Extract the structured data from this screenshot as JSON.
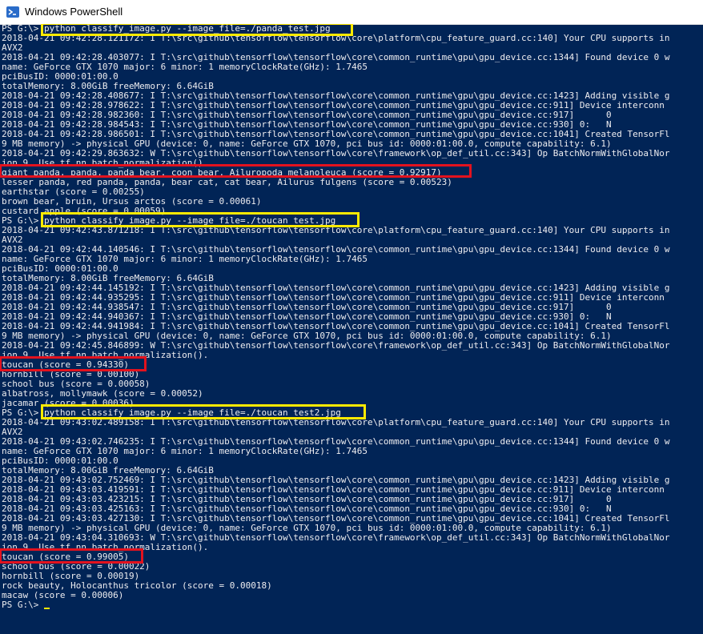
{
  "window": {
    "title": "Windows PowerShell",
    "icon": "powershell-icon",
    "colors": {
      "background": "#012456",
      "text": "#eeedf0",
      "command_highlight": "#ffea00",
      "result_highlight": "#e3121e"
    }
  },
  "console": {
    "prompt": "PS G:\\>",
    "lines": [
      "PS G:\\> python classify_image.py --image_file=./panda_test.jpg",
      "2018-04-21 09:42:28.121172: I T:\\src\\github\\tensorflow\\tensorflow\\core\\platform\\cpu_feature_guard.cc:140] Your CPU supports in",
      "AVX2",
      "2018-04-21 09:42:28.403077: I T:\\src\\github\\tensorflow\\tensorflow\\core\\common_runtime\\gpu\\gpu_device.cc:1344] Found device 0 w",
      "name: GeForce GTX 1070 major: 6 minor: 1 memoryClockRate(GHz): 1.7465",
      "pciBusID: 0000:01:00.0",
      "totalMemory: 8.00GiB freeMemory: 6.64GiB",
      "2018-04-21 09:42:28.408677: I T:\\src\\github\\tensorflow\\tensorflow\\core\\common_runtime\\gpu\\gpu_device.cc:1423] Adding visible g",
      "2018-04-21 09:42:28.978622: I T:\\src\\github\\tensorflow\\tensorflow\\core\\common_runtime\\gpu\\gpu_device.cc:911] Device interconn",
      "2018-04-21 09:42:28.982360: I T:\\src\\github\\tensorflow\\tensorflow\\core\\common_runtime\\gpu\\gpu_device.cc:917]      0",
      "2018-04-21 09:42:28.984543: I T:\\src\\github\\tensorflow\\tensorflow\\core\\common_runtime\\gpu\\gpu_device.cc:930] 0:   N",
      "2018-04-21 09:42:28.986501: I T:\\src\\github\\tensorflow\\tensorflow\\core\\common_runtime\\gpu\\gpu_device.cc:1041] Created TensorFl",
      "9 MB memory) -> physical GPU (device: 0, name: GeForce GTX 1070, pci bus id: 0000:01:00.0, compute capability: 6.1)",
      "2018-04-21 09:42:29.863632: W T:\\src\\github\\tensorflow\\tensorflow\\core\\framework\\op_def_util.cc:343] Op BatchNormWithGlobalNor",
      "ion 9. Use tf.nn.batch_normalization().",
      "giant panda, panda, panda bear, coon bear, Ailuropoda melanoleuca (score = 0.92917)",
      "lesser panda, red panda, panda, bear cat, cat bear, Ailurus fulgens (score = 0.00523)",
      "earthstar (score = 0.00255)",
      "brown bear, bruin, Ursus arctos (score = 0.00061)",
      "custard apple (score = 0.00059)",
      "PS G:\\> python classify_image.py --image_file=./toucan_test.jpg",
      "2018-04-21 09:42:43.871218: I T:\\src\\github\\tensorflow\\tensorflow\\core\\platform\\cpu_feature_guard.cc:140] Your CPU supports in",
      "AVX2",
      "2018-04-21 09:42:44.140546: I T:\\src\\github\\tensorflow\\tensorflow\\core\\common_runtime\\gpu\\gpu_device.cc:1344] Found device 0 w",
      "name: GeForce GTX 1070 major: 6 minor: 1 memoryClockRate(GHz): 1.7465",
      "pciBusID: 0000:01:00.0",
      "totalMemory: 8.00GiB freeMemory: 6.64GiB",
      "2018-04-21 09:42:44.145192: I T:\\src\\github\\tensorflow\\tensorflow\\core\\common_runtime\\gpu\\gpu_device.cc:1423] Adding visible g",
      "2018-04-21 09:42:44.935295: I T:\\src\\github\\tensorflow\\tensorflow\\core\\common_runtime\\gpu\\gpu_device.cc:911] Device interconn",
      "2018-04-21 09:42:44.938547: I T:\\src\\github\\tensorflow\\tensorflow\\core\\common_runtime\\gpu\\gpu_device.cc:917]      0",
      "2018-04-21 09:42:44.940367: I T:\\src\\github\\tensorflow\\tensorflow\\core\\common_runtime\\gpu\\gpu_device.cc:930] 0:   N",
      "2018-04-21 09:42:44.941984: I T:\\src\\github\\tensorflow\\tensorflow\\core\\common_runtime\\gpu\\gpu_device.cc:1041] Created TensorFl",
      "9 MB memory) -> physical GPU (device: 0, name: GeForce GTX 1070, pci bus id: 0000:01:00.0, compute capability: 6.1)",
      "2018-04-21 09:42:45.846899: W T:\\src\\github\\tensorflow\\tensorflow\\core\\framework\\op_def_util.cc:343] Op BatchNormWithGlobalNor",
      "ion 9. Use tf.nn.batch_normalization().",
      "toucan (score = 0.94330)",
      "hornbill (score = 0.00100)",
      "school bus (score = 0.00058)",
      "albatross, mollymawk (score = 0.00052)",
      "jacamar (score = 0.00036)",
      "PS G:\\> python classify_image.py --image_file=./toucan_test2.jpg",
      "2018-04-21 09:43:02.489158: I T:\\src\\github\\tensorflow\\tensorflow\\core\\platform\\cpu_feature_guard.cc:140] Your CPU supports in",
      "AVX2",
      "2018-04-21 09:43:02.746235: I T:\\src\\github\\tensorflow\\tensorflow\\core\\common_runtime\\gpu\\gpu_device.cc:1344] Found device 0 w",
      "name: GeForce GTX 1070 major: 6 minor: 1 memoryClockRate(GHz): 1.7465",
      "pciBusID: 0000:01:00.0",
      "totalMemory: 8.00GiB freeMemory: 6.64GiB",
      "2018-04-21 09:43:02.752469: I T:\\src\\github\\tensorflow\\tensorflow\\core\\common_runtime\\gpu\\gpu_device.cc:1423] Adding visible g",
      "2018-04-21 09:43:03.419591: I T:\\src\\github\\tensorflow\\tensorflow\\core\\common_runtime\\gpu\\gpu_device.cc:911] Device interconn",
      "2018-04-21 09:43:03.423215: I T:\\src\\github\\tensorflow\\tensorflow\\core\\common_runtime\\gpu\\gpu_device.cc:917]      0",
      "2018-04-21 09:43:03.425163: I T:\\src\\github\\tensorflow\\tensorflow\\core\\common_runtime\\gpu\\gpu_device.cc:930] 0:   N",
      "2018-04-21 09:43:03.427130: I T:\\src\\github\\tensorflow\\tensorflow\\core\\common_runtime\\gpu\\gpu_device.cc:1041] Created TensorFl",
      "9 MB memory) -> physical GPU (device: 0, name: GeForce GTX 1070, pci bus id: 0000:01:00.0, compute capability: 6.1)",
      "2018-04-21 09:43:04.310693: W T:\\src\\github\\tensorflow\\tensorflow\\core\\framework\\op_def_util.cc:343] Op BatchNormWithGlobalNor",
      "ion 9. Use tf.nn.batch_normalization().",
      "toucan (score = 0.99005)",
      "school bus (score = 0.00022)",
      "hornbill (score = 0.00019)",
      "rock beauty, Holocanthus tricolor (score = 0.00018)",
      "macaw (score = 0.00006)",
      "PS G:\\> "
    ]
  }
}
